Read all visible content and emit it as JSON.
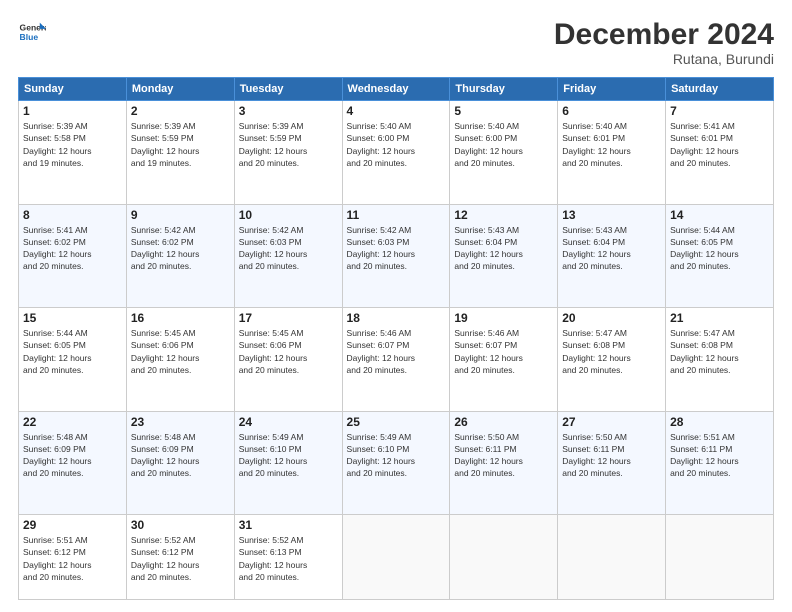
{
  "header": {
    "logo_line1": "General",
    "logo_line2": "Blue",
    "month": "December 2024",
    "location": "Rutana, Burundi"
  },
  "days_of_week": [
    "Sunday",
    "Monday",
    "Tuesday",
    "Wednesday",
    "Thursday",
    "Friday",
    "Saturday"
  ],
  "weeks": [
    [
      {
        "day": "1",
        "sunrise": "5:39 AM",
        "sunset": "5:58 PM",
        "daylight": "12 hours and 19 minutes."
      },
      {
        "day": "2",
        "sunrise": "5:39 AM",
        "sunset": "5:59 PM",
        "daylight": "12 hours and 19 minutes."
      },
      {
        "day": "3",
        "sunrise": "5:39 AM",
        "sunset": "5:59 PM",
        "daylight": "12 hours and 20 minutes."
      },
      {
        "day": "4",
        "sunrise": "5:40 AM",
        "sunset": "6:00 PM",
        "daylight": "12 hours and 20 minutes."
      },
      {
        "day": "5",
        "sunrise": "5:40 AM",
        "sunset": "6:00 PM",
        "daylight": "12 hours and 20 minutes."
      },
      {
        "day": "6",
        "sunrise": "5:40 AM",
        "sunset": "6:01 PM",
        "daylight": "12 hours and 20 minutes."
      },
      {
        "day": "7",
        "sunrise": "5:41 AM",
        "sunset": "6:01 PM",
        "daylight": "12 hours and 20 minutes."
      }
    ],
    [
      {
        "day": "8",
        "sunrise": "5:41 AM",
        "sunset": "6:02 PM",
        "daylight": "12 hours and 20 minutes."
      },
      {
        "day": "9",
        "sunrise": "5:42 AM",
        "sunset": "6:02 PM",
        "daylight": "12 hours and 20 minutes."
      },
      {
        "day": "10",
        "sunrise": "5:42 AM",
        "sunset": "6:03 PM",
        "daylight": "12 hours and 20 minutes."
      },
      {
        "day": "11",
        "sunrise": "5:42 AM",
        "sunset": "6:03 PM",
        "daylight": "12 hours and 20 minutes."
      },
      {
        "day": "12",
        "sunrise": "5:43 AM",
        "sunset": "6:04 PM",
        "daylight": "12 hours and 20 minutes."
      },
      {
        "day": "13",
        "sunrise": "5:43 AM",
        "sunset": "6:04 PM",
        "daylight": "12 hours and 20 minutes."
      },
      {
        "day": "14",
        "sunrise": "5:44 AM",
        "sunset": "6:05 PM",
        "daylight": "12 hours and 20 minutes."
      }
    ],
    [
      {
        "day": "15",
        "sunrise": "5:44 AM",
        "sunset": "6:05 PM",
        "daylight": "12 hours and 20 minutes."
      },
      {
        "day": "16",
        "sunrise": "5:45 AM",
        "sunset": "6:06 PM",
        "daylight": "12 hours and 20 minutes."
      },
      {
        "day": "17",
        "sunrise": "5:45 AM",
        "sunset": "6:06 PM",
        "daylight": "12 hours and 20 minutes."
      },
      {
        "day": "18",
        "sunrise": "5:46 AM",
        "sunset": "6:07 PM",
        "daylight": "12 hours and 20 minutes."
      },
      {
        "day": "19",
        "sunrise": "5:46 AM",
        "sunset": "6:07 PM",
        "daylight": "12 hours and 20 minutes."
      },
      {
        "day": "20",
        "sunrise": "5:47 AM",
        "sunset": "6:08 PM",
        "daylight": "12 hours and 20 minutes."
      },
      {
        "day": "21",
        "sunrise": "5:47 AM",
        "sunset": "6:08 PM",
        "daylight": "12 hours and 20 minutes."
      }
    ],
    [
      {
        "day": "22",
        "sunrise": "5:48 AM",
        "sunset": "6:09 PM",
        "daylight": "12 hours and 20 minutes."
      },
      {
        "day": "23",
        "sunrise": "5:48 AM",
        "sunset": "6:09 PM",
        "daylight": "12 hours and 20 minutes."
      },
      {
        "day": "24",
        "sunrise": "5:49 AM",
        "sunset": "6:10 PM",
        "daylight": "12 hours and 20 minutes."
      },
      {
        "day": "25",
        "sunrise": "5:49 AM",
        "sunset": "6:10 PM",
        "daylight": "12 hours and 20 minutes."
      },
      {
        "day": "26",
        "sunrise": "5:50 AM",
        "sunset": "6:11 PM",
        "daylight": "12 hours and 20 minutes."
      },
      {
        "day": "27",
        "sunrise": "5:50 AM",
        "sunset": "6:11 PM",
        "daylight": "12 hours and 20 minutes."
      },
      {
        "day": "28",
        "sunrise": "5:51 AM",
        "sunset": "6:11 PM",
        "daylight": "12 hours and 20 minutes."
      }
    ],
    [
      {
        "day": "29",
        "sunrise": "5:51 AM",
        "sunset": "6:12 PM",
        "daylight": "12 hours and 20 minutes."
      },
      {
        "day": "30",
        "sunrise": "5:52 AM",
        "sunset": "6:12 PM",
        "daylight": "12 hours and 20 minutes."
      },
      {
        "day": "31",
        "sunrise": "5:52 AM",
        "sunset": "6:13 PM",
        "daylight": "12 hours and 20 minutes."
      },
      null,
      null,
      null,
      null
    ]
  ]
}
